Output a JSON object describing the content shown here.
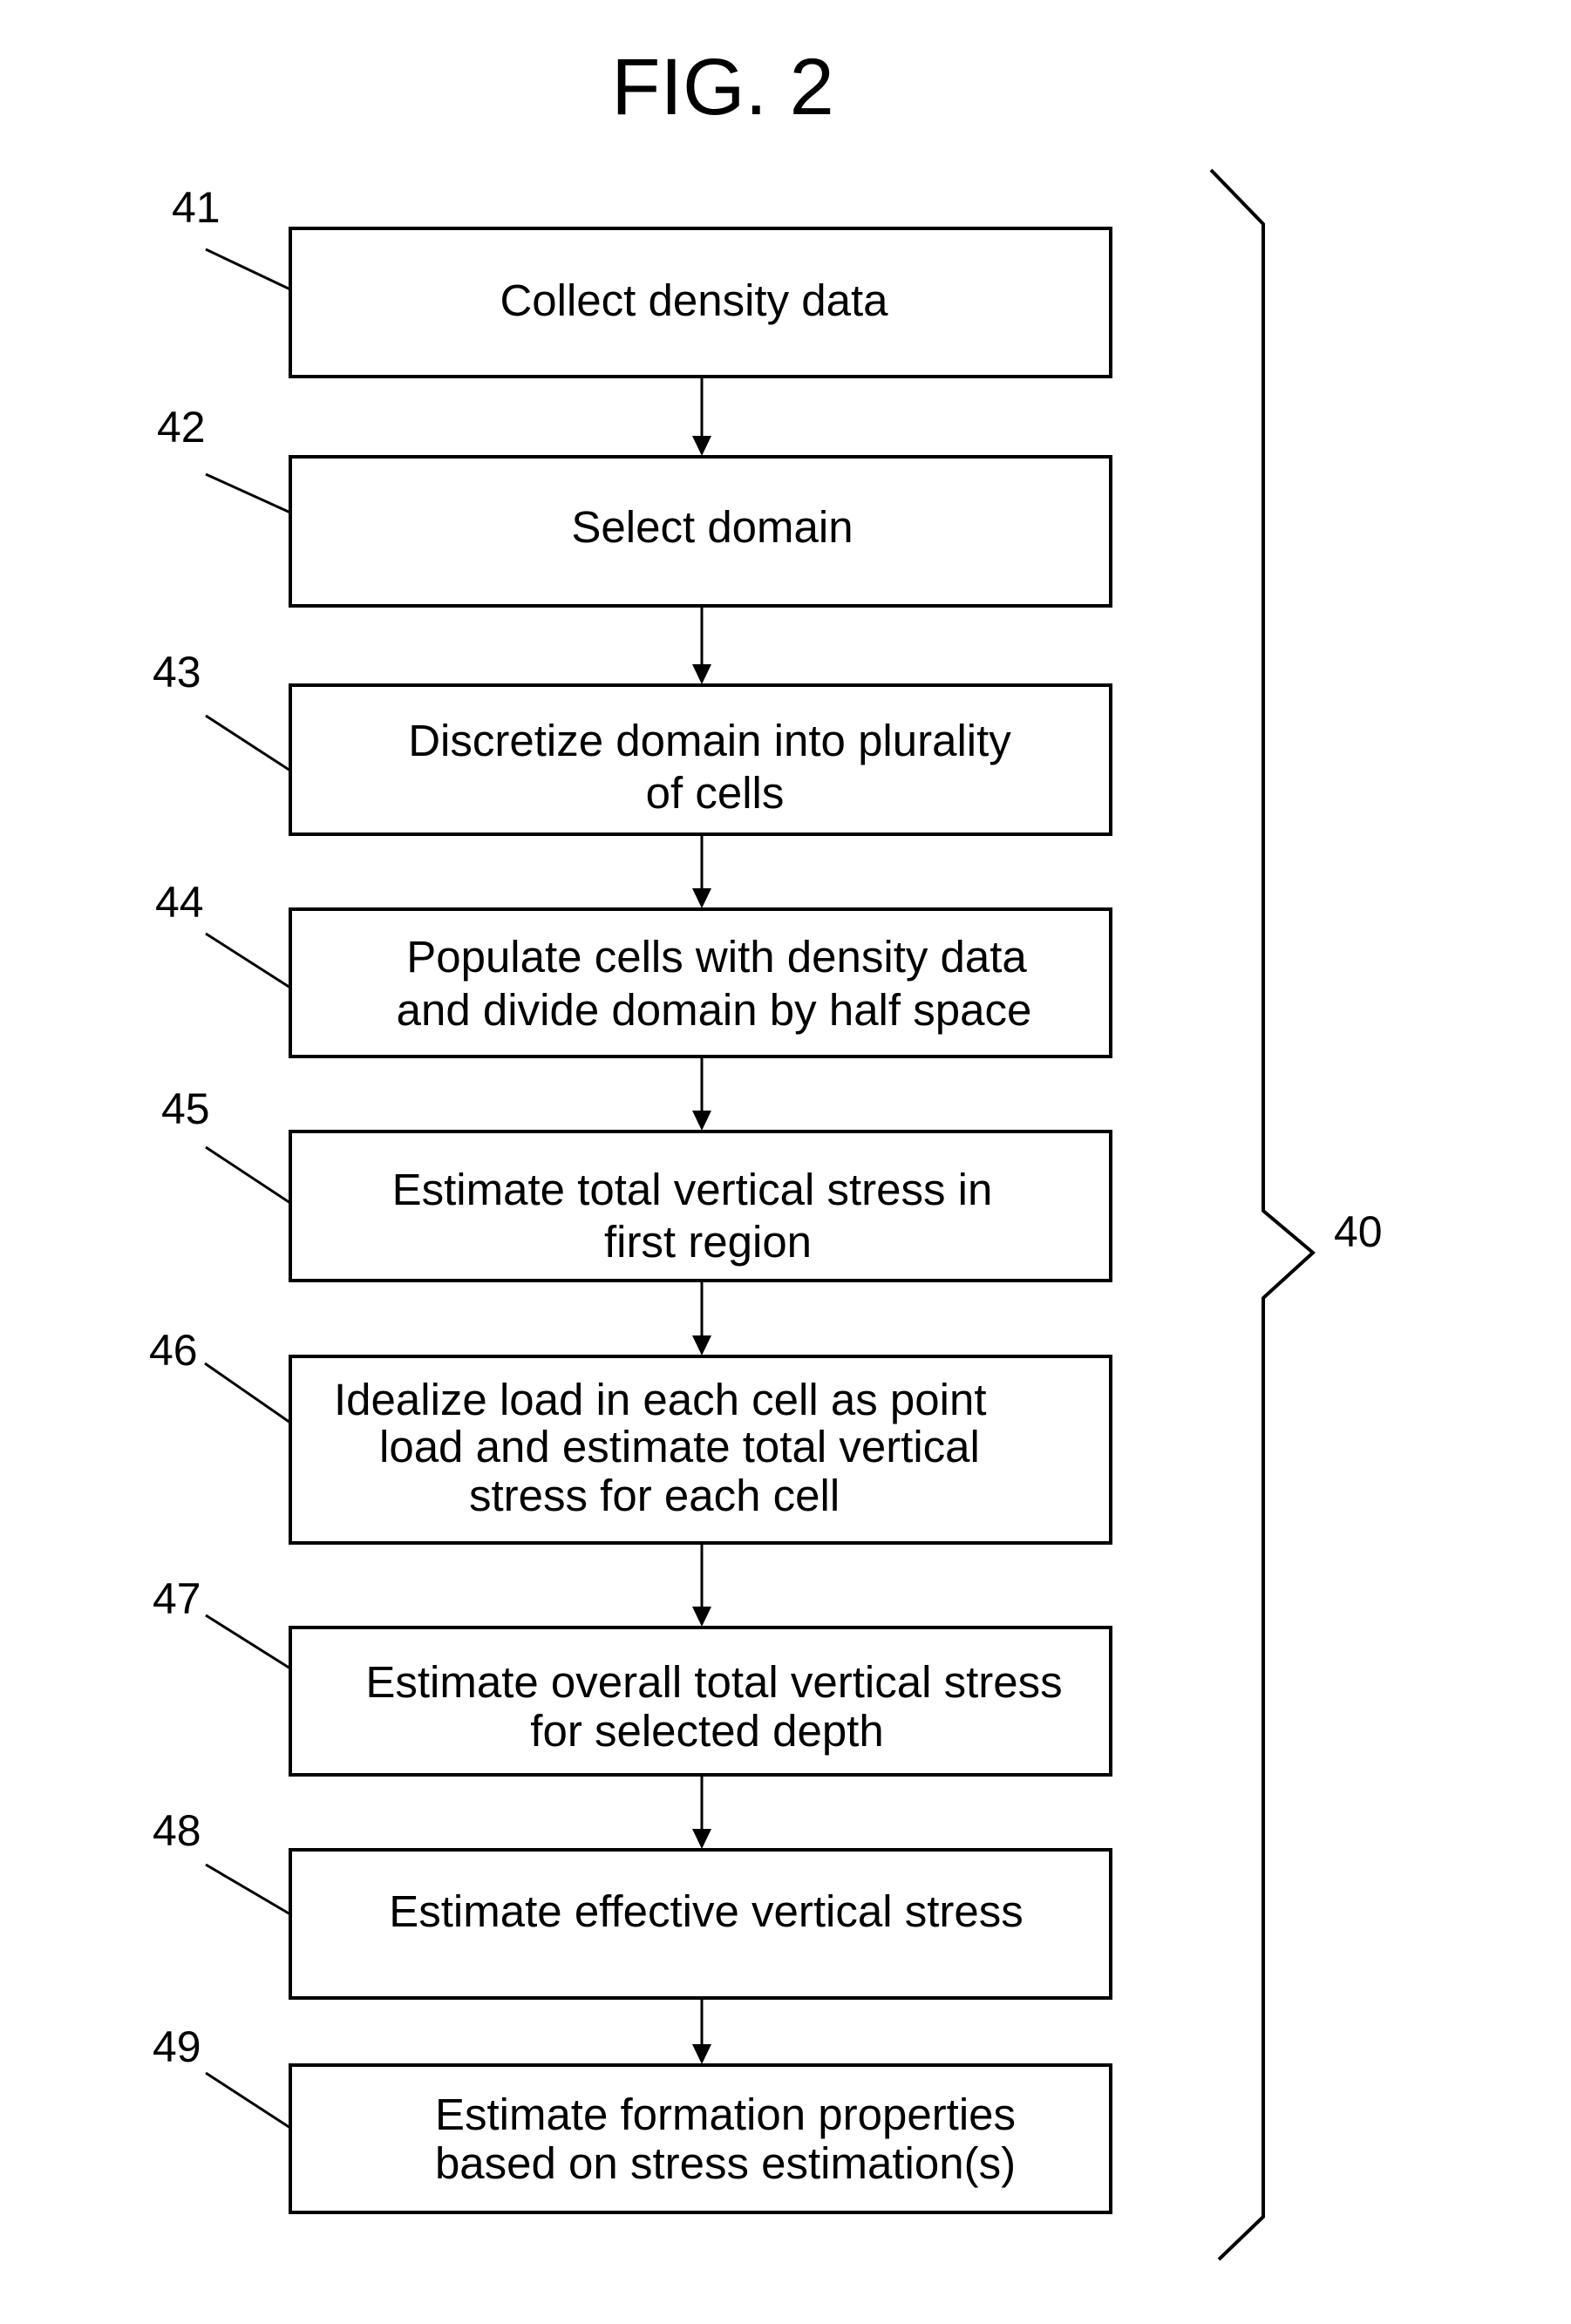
{
  "figure": {
    "title": "FIG. 2",
    "process_ref": "40",
    "steps": [
      {
        "ref": "41",
        "lines": [
          "Collect density data"
        ]
      },
      {
        "ref": "42",
        "lines": [
          "Select domain"
        ]
      },
      {
        "ref": "43",
        "lines": [
          "Discretize domain into plurality",
          "of cells"
        ]
      },
      {
        "ref": "44",
        "lines": [
          "Populate cells with density data",
          "and divide domain by half space"
        ]
      },
      {
        "ref": "45",
        "lines": [
          "Estimate total vertical stress in",
          "first region"
        ]
      },
      {
        "ref": "46",
        "lines": [
          "Idealize load in each cell as point",
          "load and estimate total vertical",
          "stress for each cell"
        ]
      },
      {
        "ref": "47",
        "lines": [
          "Estimate overall total vertical stress",
          "for selected depth"
        ]
      },
      {
        "ref": "48",
        "lines": [
          "Estimate effective vertical stress"
        ]
      },
      {
        "ref": "49",
        "lines": [
          "Estimate formation properties",
          "based on stress estimation(s)"
        ]
      }
    ]
  }
}
